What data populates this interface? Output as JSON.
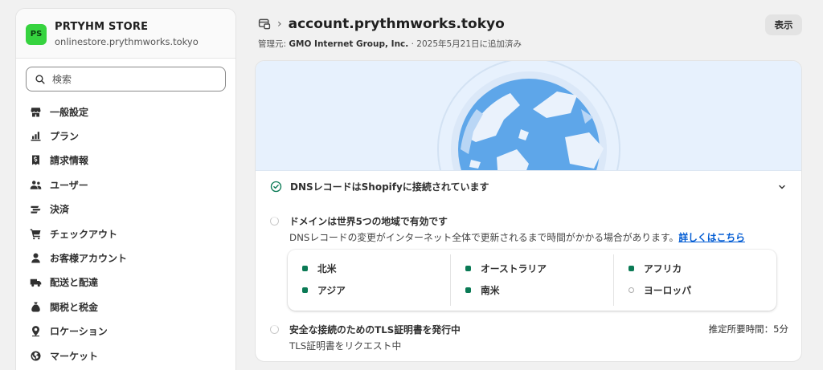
{
  "store": {
    "initials": "PS",
    "name": "PRTYHM STORE",
    "domain": "onlinestore.prythmworks.tokyo",
    "avatar_color": "#36d33f"
  },
  "search": {
    "placeholder": "検索"
  },
  "nav": [
    {
      "label": "一般設定",
      "icon": "store-icon"
    },
    {
      "label": "プラン",
      "icon": "plan-icon"
    },
    {
      "label": "請求情報",
      "icon": "billing-icon"
    },
    {
      "label": "ユーザー",
      "icon": "users-icon"
    },
    {
      "label": "決済",
      "icon": "payments-icon"
    },
    {
      "label": "チェックアウト",
      "icon": "cart-icon"
    },
    {
      "label": "お客様アカウント",
      "icon": "person-icon"
    },
    {
      "label": "配送と配達",
      "icon": "truck-icon"
    },
    {
      "label": "関税と税金",
      "icon": "tax-icon"
    },
    {
      "label": "ロケーション",
      "icon": "location-icon"
    },
    {
      "label": "マーケット",
      "icon": "globe-icon"
    }
  ],
  "header": {
    "title": "account.prythmworks.tokyo",
    "managed_by_label": "管理元:",
    "managed_by": "GMO Internet Group, Inc.",
    "added": "· 2025年5月21日に追加済み",
    "show_button": "表示"
  },
  "dns": {
    "status": "DNSレコードはShopifyに接続されています",
    "accent": "#0a7a55"
  },
  "regions_step": {
    "title": "ドメインは世界5つの地域で有効です",
    "desc": "DNSレコードの変更がインターネット全体で更新されるまで時間がかかる場合があります。",
    "link": "詳しくはこちら",
    "columns": [
      [
        {
          "name": "北米",
          "active": true
        },
        {
          "name": "アジア",
          "active": true
        }
      ],
      [
        {
          "name": "オーストラリア",
          "active": true
        },
        {
          "name": "南米",
          "active": true
        }
      ],
      [
        {
          "name": "アフリカ",
          "active": true
        },
        {
          "name": "ヨーロッパ",
          "active": false
        }
      ]
    ]
  },
  "tls_step": {
    "title": "安全な接続のためのTLS証明書を発行中",
    "desc": "TLS証明書をリクエスト中",
    "estimate": "推定所要時間：5分"
  }
}
